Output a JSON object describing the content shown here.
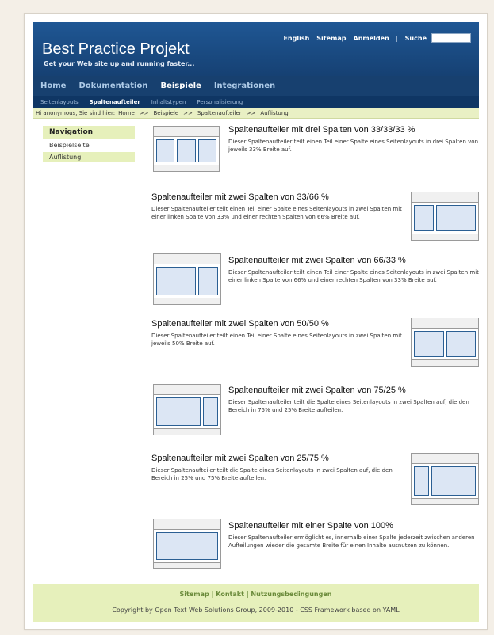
{
  "header": {
    "title": "Best Practice Projekt",
    "subtitle": "Get your Web site up and running faster...",
    "utility_links": [
      "English",
      "Sitemap",
      "Anmelden"
    ],
    "search_label": "Suche",
    "search_value": ""
  },
  "main_nav": [
    {
      "label": "Home",
      "active": false
    },
    {
      "label": "Dokumentation",
      "active": false
    },
    {
      "label": "Beispiele",
      "active": true
    },
    {
      "label": "Integrationen",
      "active": false
    }
  ],
  "sub_nav": [
    {
      "label": "Seitenlayouts",
      "active": false
    },
    {
      "label": "Spaltenaufteiler",
      "active": true
    },
    {
      "label": "Inhaltstypen",
      "active": false
    },
    {
      "label": "Personalisierung",
      "active": false
    }
  ],
  "breadcrumb": {
    "prefix": "Hi anonymous, Sie sind hier:",
    "links": [
      "Home",
      "Beispiele",
      "Spaltenaufteiler"
    ],
    "separator": ">>",
    "current": "Auflistung"
  },
  "sidebar": {
    "title": "Navigation",
    "items": [
      {
        "label": "Beispielseite",
        "active": false
      },
      {
        "label": "Auflistung",
        "active": true
      }
    ]
  },
  "entries": [
    {
      "title": "Spaltenaufteiler mit drei Spalten von 33/33/33 %",
      "desc": "Dieser Spaltenaufteiler teilt einen Teil einer Spalte eines Seitenlayouts in drei Spalten von jeweils 33% Breite auf.",
      "split": [
        33,
        33,
        33
      ]
    },
    {
      "title": "Spaltenaufteiler mit zwei Spalten von 33/66 %",
      "desc": "Dieser Spaltenaufteiler teilt einen Teil einer Spalte eines Seitenlayouts in zwei Spalten mit einer linken Spalte von 33% und einer rechten Spalten von 66% Breite auf.",
      "split": [
        33,
        66
      ]
    },
    {
      "title": "Spaltenaufteiler mit zwei Spalten von 66/33 %",
      "desc": "Dieser Spaltenaufteiler teilt einen Teil einer Spalte eines Seitenlayouts in zwei Spalten mit einer linken Spalte von 66% und einer rechten Spalten von 33% Breite auf.",
      "split": [
        66,
        33
      ]
    },
    {
      "title": "Spaltenaufteiler mit zwei Spalten von 50/50 %",
      "desc": "Dieser Spaltenaufteiler teilt einen Teil einer Spalte eines Seitenlayouts in zwei Spalten mit jeweils 50% Breite auf.",
      "split": [
        50,
        50
      ]
    },
    {
      "title": "Spaltenaufteiler mit zwei Spalten von 75/25 %",
      "desc": "Dieser Spaltenaufteiler teilt die Spalte eines Seitenlayouts in zwei Spalten auf, die den Bereich in 75% und 25% Breite aufteilen.",
      "split": [
        75,
        25
      ]
    },
    {
      "title": "Spaltenaufteiler mit zwei Spalten von 25/75 %",
      "desc": "Dieser Spaltenaufteiler teilt die Spalte eines Seitenlayouts in zwei Spalten auf, die den Bereich in 25% und 75% Breite aufteilen.",
      "split": [
        25,
        75
      ]
    },
    {
      "title": "Spaltenaufteiler mit einer Spalte von 100%",
      "desc": "Dieser Spaltenaufteiler ermöglicht es, innerhalb einer Spalte jederzeit zwischen anderen Aufteilungen wieder die gesamte Breite für einen Inhalte ausnutzen zu können.",
      "split": [
        100
      ]
    }
  ],
  "footer": {
    "links": [
      "Sitemap",
      "Kontakt",
      "Nutzungsbedingungen"
    ],
    "copyright": "Copyright by Open Text Web Solutions Group, 2009-2010 - CSS Framework based on YAML"
  }
}
